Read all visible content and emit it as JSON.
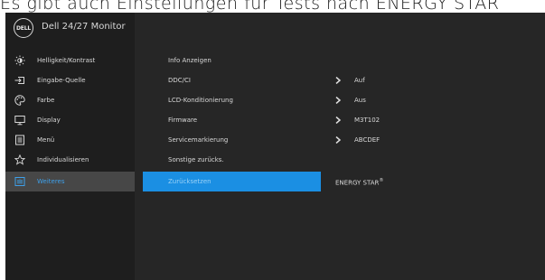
{
  "caption": "Es gibt auch Einstellungen für Tests nach ENERGY STAR",
  "header": {
    "logo_text": "DELL",
    "model_title": "Dell 24/27 Monitor"
  },
  "sidebar": {
    "items": [
      {
        "label": "Helligkeit/Kontrast",
        "icon": "brightness-icon"
      },
      {
        "label": "Eingabe-Quelle",
        "icon": "input-source-icon"
      },
      {
        "label": "Farbe",
        "icon": "color-palette-icon"
      },
      {
        "label": "Display",
        "icon": "display-icon"
      },
      {
        "label": "Menü",
        "icon": "menu-icon"
      },
      {
        "label": "Individualisieren",
        "icon": "star-icon"
      },
      {
        "label": "Weiteres",
        "icon": "others-icon",
        "active": true
      }
    ]
  },
  "main": {
    "items": [
      {
        "label": "Info Anzeigen",
        "value": ""
      },
      {
        "label": "DDC/CI",
        "value": "Auf"
      },
      {
        "label": "LCD-Konditionierung",
        "value": "Aus"
      },
      {
        "label": "Firmware",
        "value": "M3T102"
      },
      {
        "label": "Servicemarkierung",
        "value": "ABCDEF"
      },
      {
        "label": "Sonstige zurücks.",
        "value": ""
      },
      {
        "label": "Zurücksetzen",
        "value": "",
        "selected": true
      }
    ],
    "energy_star": "ENERGY STAR",
    "energy_star_mark": "®"
  },
  "colors": {
    "accent": "#1b8fe3",
    "active_text": "#3ea0ea",
    "panel_bg": "#262626",
    "sidebar_bg": "#1e1e1e",
    "active_bg": "#474747"
  }
}
